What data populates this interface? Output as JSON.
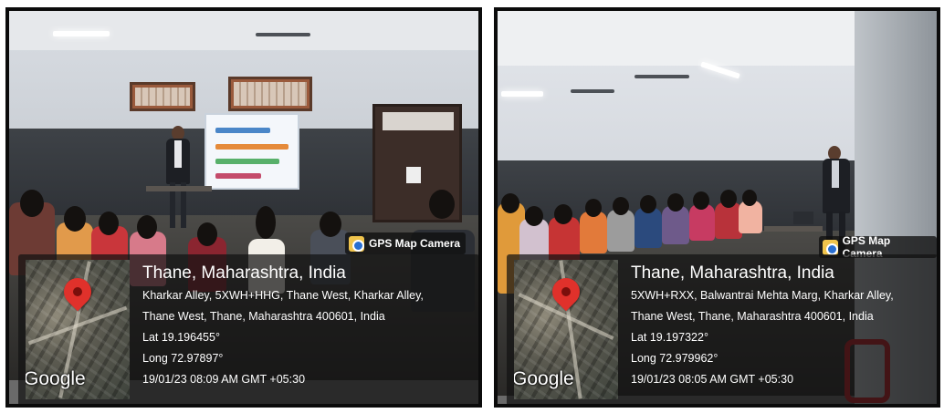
{
  "photos": [
    {
      "badge": "GPS Map Camera",
      "map_label": "Google",
      "location_title": "Thane, Maharashtra, India",
      "address_line1": "Kharkar Alley, 5XWH+HHG, Thane West, Kharkar Alley,",
      "address_line2": "Thane West, Thane, Maharashtra 400601, India",
      "latitude": "Lat 19.196455°",
      "longitude": "Long 72.97897°",
      "datetime": "19/01/23 08:09 AM GMT +05:30"
    },
    {
      "badge": "GPS Map Camera",
      "map_label": "Google",
      "location_title": "Thane, Maharashtra, India",
      "address_line1": "5XWH+RXX, Balwantrai Mehta Marg, Kharkar Alley,",
      "address_line2": "Thane West, Thane, Maharashtra 400601, India",
      "latitude": "Lat 19.197322°",
      "longitude": "Long 72.979962°",
      "datetime": "19/01/23 08:05 AM GMT +05:30"
    }
  ],
  "colors": {
    "pin": "#e0312b",
    "frame": "#0b0b0b",
    "overlay": "#121212"
  },
  "icons": {
    "badge_icon": "camera-location-icon",
    "map_marker": "map-pin-icon"
  }
}
